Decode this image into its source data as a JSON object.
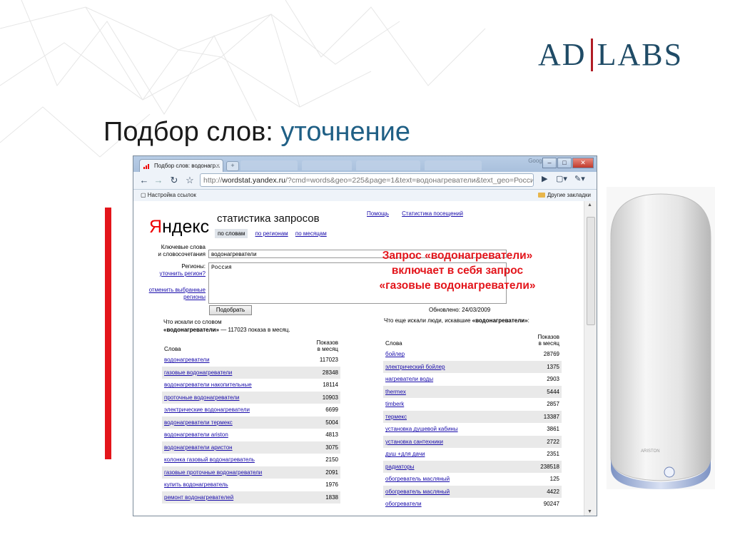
{
  "logo": {
    "left": "AD",
    "right": "LABS"
  },
  "slide": {
    "title_main": "Подбор слов: ",
    "title_accent": "уточнение"
  },
  "callout": {
    "line1": "Запрос «водонагреватели»",
    "line2": "включает в себя запрос",
    "line3": "«газовые водонагреватели»"
  },
  "browser": {
    "tab_title": "Подбор слов: водонагр...",
    "tab_close": "×",
    "brand": "Google",
    "url_prefix": "http://",
    "url_host": "wordstat.yandex.ru",
    "url_rest": "/?cmd=words&geo=225&page=1&text=водонагреватели&text_geo=Россия",
    "bookmark_left": "Настройка ссылок",
    "bookmark_right": "Другие закладки"
  },
  "page": {
    "logo_red": "Я",
    "logo_rest": "ндекс",
    "title": "статистика запросов",
    "tabs": [
      "по словам",
      "по регионам",
      "по месяцам"
    ],
    "top_links": [
      "Помощь",
      "Статистика посещений"
    ],
    "kw_label_1": "Ключевые слова",
    "kw_label_2": "и словосочетания",
    "kw_value": "водонагреватели",
    "region_label": "Регионы:",
    "region_link": "уточнить регион?",
    "region_cancel_1": "отменить выбранные",
    "region_cancel_2": "регионы",
    "region_value": "Россия",
    "submit": "Подобрать",
    "updated": "Обновлено: 24/03/2009",
    "left_head_1": "Что искали со словом",
    "left_head_bold": "«водонагреватели»",
    "left_head_rest": " — 117023 показа в месяц.",
    "right_head_pre": "Что еще искали люди, искавшие ",
    "right_head_bold": "«водонагреватели»",
    "right_head_post": ":",
    "col_words": "Слова",
    "col_shows_1": "Показов",
    "col_shows_2": "в месяц"
  },
  "left_rows": [
    {
      "kw": "водонагреватели",
      "n": "117023"
    },
    {
      "kw": "газовые водонагреватели",
      "n": "28348"
    },
    {
      "kw": "водонагреватели накопительные",
      "n": "18114"
    },
    {
      "kw": "проточные водонагреватели",
      "n": "10903"
    },
    {
      "kw": "электрические водонагреватели",
      "n": "6699"
    },
    {
      "kw": "водонагреватели термекс",
      "n": "5004"
    },
    {
      "kw": "водонагреватели ariston",
      "n": "4813"
    },
    {
      "kw": "водонагреватели аристон",
      "n": "3075"
    },
    {
      "kw": "колонка газовый водонагреватель",
      "n": "2150"
    },
    {
      "kw": "газовые проточные водонагреватели",
      "n": "2091"
    },
    {
      "kw": "купить водонагреватель",
      "n": "1976"
    },
    {
      "kw": "ремонт водонагревателей",
      "n": "1838"
    }
  ],
  "right_rows": [
    {
      "kw": "бойлер",
      "n": "28769"
    },
    {
      "kw": "электрический бойлер",
      "n": "1375"
    },
    {
      "kw": "нагреватели воды",
      "n": "2903"
    },
    {
      "kw": "thermex",
      "n": "5444"
    },
    {
      "kw": "timberk",
      "n": "2857"
    },
    {
      "kw": "термекс",
      "n": "13387"
    },
    {
      "kw": "установка душевой кабины",
      "n": "3861"
    },
    {
      "kw": "установка сантехники",
      "n": "2722"
    },
    {
      "kw": "душ +для дачи",
      "n": "2351"
    },
    {
      "kw": "радиаторы",
      "n": "238518"
    },
    {
      "kw": "обогреватель масляный",
      "n": "125"
    },
    {
      "kw": "обогреватель масляный",
      "n": "4422"
    },
    {
      "kw": "обогреватели",
      "n": "90247"
    }
  ],
  "heater": {
    "brand": "ARISTON"
  },
  "colors": {
    "accent_red": "#e3151b",
    "logo_blue": "#1f4b66",
    "link": "#1a0dab"
  }
}
